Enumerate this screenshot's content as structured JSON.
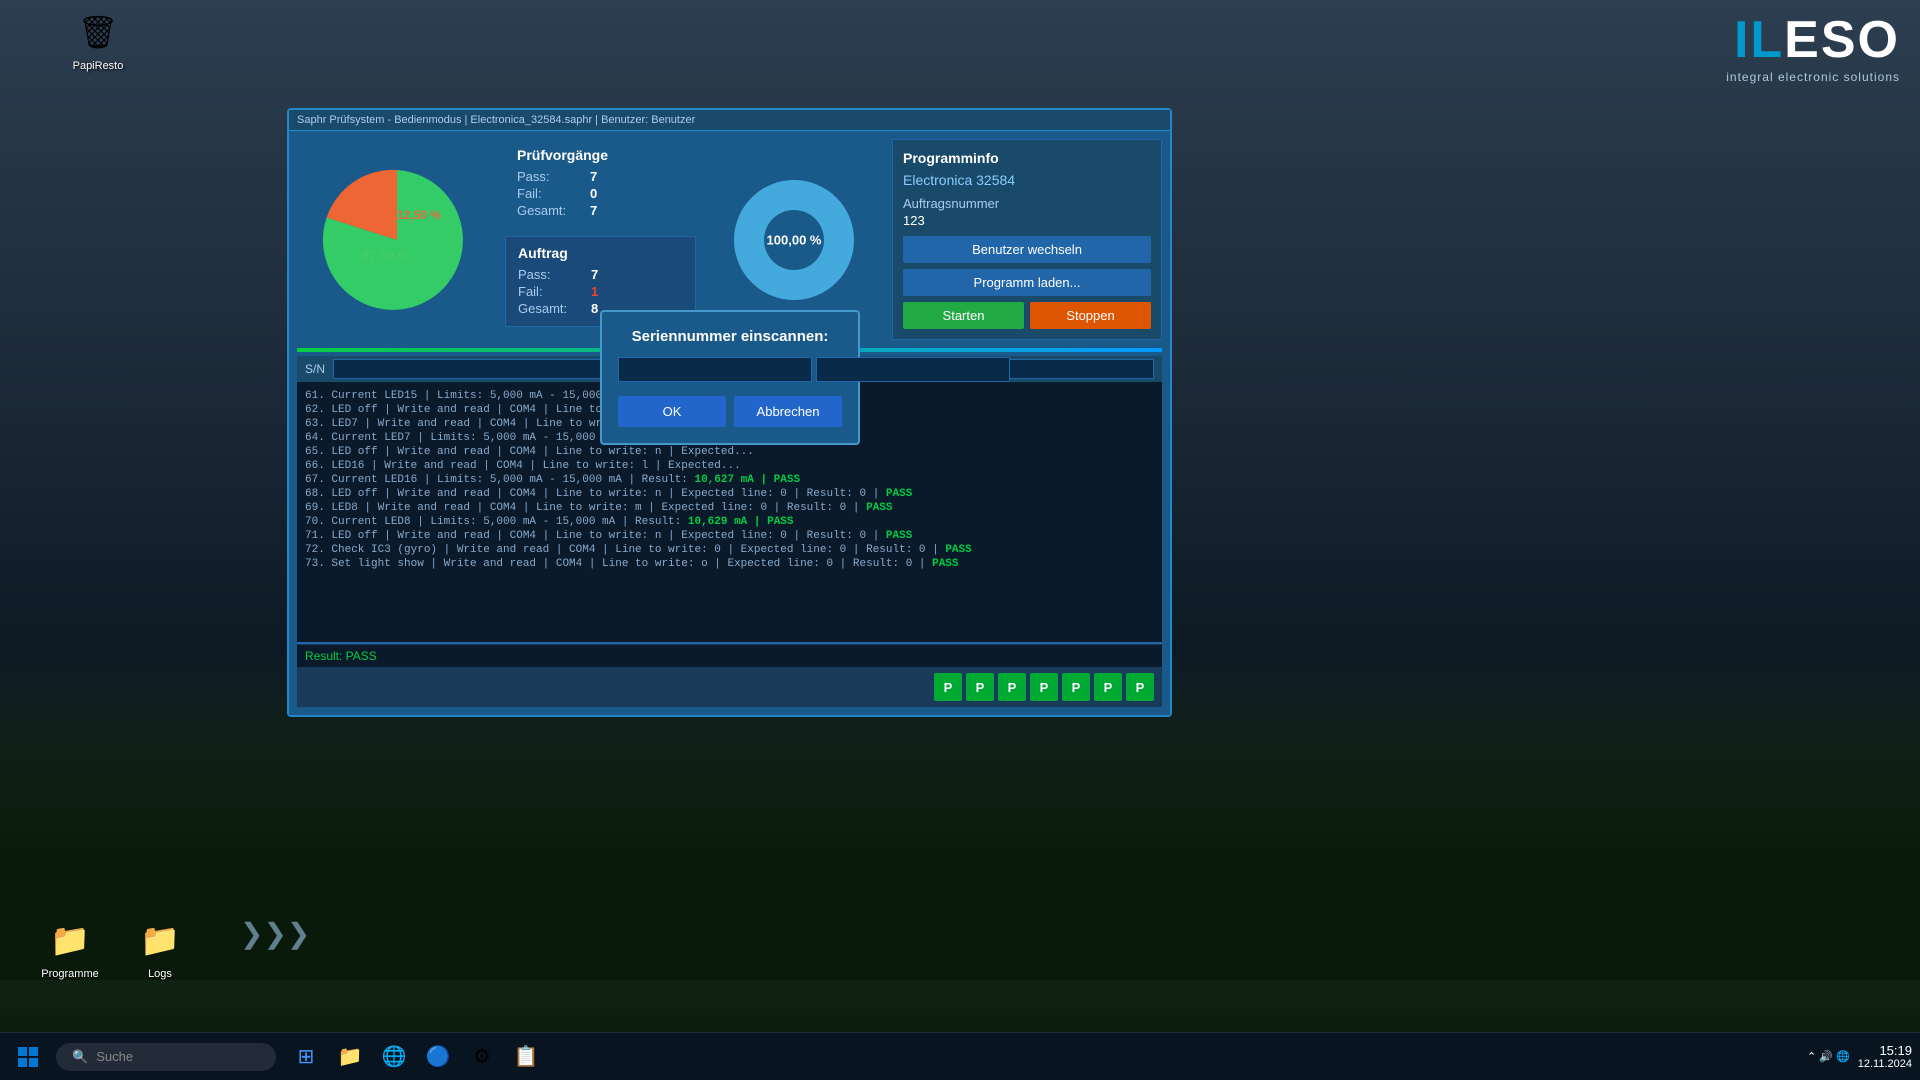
{
  "desktop": {
    "icons": [
      {
        "id": "recycle-bin",
        "label": "PapiResto",
        "icon": "🗑"
      },
      {
        "id": "programme",
        "label": "Programme",
        "icon": "📁"
      },
      {
        "id": "logs",
        "label": "Logs",
        "icon": "📁"
      }
    ]
  },
  "ileso": {
    "title": "ILESO",
    "subtitle": "integral electronic solutions"
  },
  "window": {
    "title": "Saphr Prüfsystem - Bedienmodus | Electronica_32584.saphr | Benutzer: Benutzer",
    "pruefvorgaenge": {
      "title": "Prüfvorgänge",
      "pass_label": "Pass:",
      "pass_value": "7",
      "fail_label": "Fail:",
      "fail_value": "0",
      "gesamt_label": "Gesamt:",
      "gesamt_value": "7"
    },
    "auftrag": {
      "title": "Auftrag",
      "pass_label": "Pass:",
      "pass_value": "7",
      "fail_label": "Fail:",
      "fail_value": "1",
      "gesamt_label": "Gesamt:",
      "gesamt_value": "8"
    },
    "pie1": {
      "percent1": "87,50 %",
      "percent2": "12,50 %"
    },
    "pie2": {
      "percent": "100,00 %"
    },
    "programinfo": {
      "title": "Programminfo",
      "name": "Electronica 32584",
      "auftragsnummer_label": "Auftragsnummer",
      "auftragsnummer_value": "123",
      "btn_benutzer": "Benutzer wechseln",
      "btn_programm": "Programm laden...",
      "btn_starten": "Starten",
      "btn_stoppen": "Stoppen"
    },
    "sn_label": "S/N",
    "log_lines": [
      "61. Current LED15 | Limits: 5,000 mA - 15,000 mA | Result: 8... | PASS",
      "62. LED off | Write and read | COM4 | Line to write: n | Expe...",
      "63. LED7 | Write and read | COM4 | Line to write: k | Expected...",
      "64. Current LED7 | Limits: 5,000 mA - 15,000 mA | Result: 10...",
      "65. LED off | Write and read | COM4 | Line to write: n | Expec...",
      "66. LED16 | Write and read | COM4 | Line to write: l | Expect...",
      "67. Current LED16 | Limits: 5,000 mA - 15,000 mA | Result: 10,627 mA | PASS",
      "68. LED off | Write and read | COM4 | Line to write: n | Expected line: 0 | Result: 0 | PASS",
      "69. LED8 | Write and read | COM4 | Line to write: m | Expected line: 0 | Result: 0 | PASS",
      "70. Current LED8 | Limits: 5,000 mA - 15,000 mA | Result: 10,629 mA | PASS",
      "71. LED off | Write and read | COM4 | Line to write: n | Expected line: 0 | Result: 0 | PASS",
      "72. Check IC3 (gyro) | Write and read | COM4 | Line to write: 0 | Expected line: 0 | Result: 0 | PASS",
      "73. Set light show | Write and read | COM4 | Line to write: o | Expected line: 0 | Result: 0 | PASS"
    ],
    "result": "Result: PASS",
    "pass_badges": [
      "P",
      "P",
      "P",
      "P",
      "P",
      "P",
      "P"
    ]
  },
  "dialog": {
    "title": "Seriennummer einscannen:",
    "input1_placeholder": "",
    "input2_placeholder": "",
    "btn_ok": "OK",
    "btn_cancel": "Abbrechen"
  },
  "taskbar": {
    "search_placeholder": "Suche",
    "time": "15:19",
    "date": "12.11.2024",
    "apps": [
      "⊞",
      "⌕",
      "🗂",
      "📁",
      "🌐",
      "🔵",
      "⚙",
      "📋"
    ]
  }
}
